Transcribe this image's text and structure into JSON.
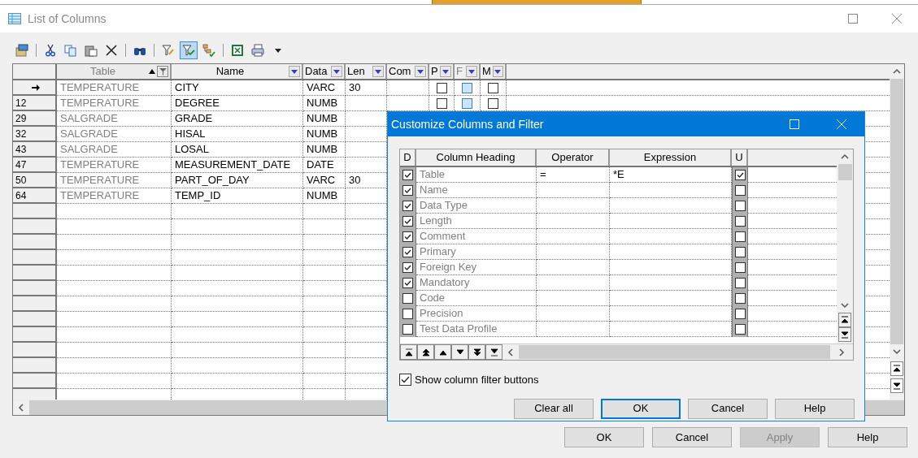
{
  "window": {
    "title": "List of Columns"
  },
  "toolbar": [
    {
      "kind": "properties",
      "pressed": false
    },
    {
      "kind": "separator"
    },
    {
      "kind": "cut",
      "pressed": false
    },
    {
      "kind": "copy",
      "pressed": false
    },
    {
      "kind": "paste",
      "pressed": false
    },
    {
      "kind": "delete",
      "pressed": false
    },
    {
      "kind": "separator"
    },
    {
      "kind": "find",
      "pressed": false
    },
    {
      "kind": "separator"
    },
    {
      "kind": "filter-edit",
      "pressed": false
    },
    {
      "kind": "filter-apply",
      "pressed": true
    },
    {
      "kind": "tree-check",
      "pressed": false
    },
    {
      "kind": "separator"
    },
    {
      "kind": "excel",
      "pressed": false
    },
    {
      "kind": "print",
      "pressed": false
    },
    {
      "kind": "caret",
      "pressed": false
    }
  ],
  "grid": {
    "columns": [
      {
        "label": "Table",
        "sorted": true,
        "filtered": true,
        "shaded": false
      },
      {
        "label": "Name",
        "sorted": false,
        "filtered": false,
        "shaded": false
      },
      {
        "label": "Data",
        "sorted": false,
        "filtered": false,
        "shaded": false
      },
      {
        "label": "Len",
        "sorted": false,
        "filtered": false,
        "shaded": false
      },
      {
        "label": "Com",
        "sorted": false,
        "filtered": false,
        "shaded": false
      },
      {
        "label": "P",
        "sorted": false,
        "filtered": false,
        "shaded": false
      },
      {
        "label": "F",
        "sorted": false,
        "filtered": false,
        "shaded": true
      },
      {
        "label": "M",
        "sorted": false,
        "filtered": false,
        "shaded": false
      }
    ],
    "rows": [
      {
        "current": true,
        "table": "TEMPERATURE",
        "name": "CITY",
        "data": "VARC",
        "len": "30",
        "flags": [
          false,
          false,
          false
        ]
      },
      {
        "current": false,
        "number": "12",
        "table": "TEMPERATURE",
        "name": "DEGREE",
        "data": "NUMB",
        "flags": [
          false,
          false,
          false
        ]
      },
      {
        "current": false,
        "number": "29",
        "table": "SALGRADE",
        "name": "GRADE",
        "data": "NUMB"
      },
      {
        "current": false,
        "number": "32",
        "table": "SALGRADE",
        "name": "HISAL",
        "data": "NUMB"
      },
      {
        "current": false,
        "number": "43",
        "table": "SALGRADE",
        "name": "LOSAL",
        "data": "NUMB"
      },
      {
        "current": false,
        "number": "47",
        "table": "TEMPERATURE",
        "name": "MEASUREMENT_DATE",
        "data": "DATE"
      },
      {
        "current": false,
        "number": "50",
        "table": "TEMPERATURE",
        "name": "PART_OF_DAY",
        "data": "VARC",
        "len": "30"
      },
      {
        "current": false,
        "number": "64",
        "table": "TEMPERATURE",
        "name": "TEMP_ID",
        "data": "NUMB"
      }
    ]
  },
  "buttons": [
    {
      "label": "OK",
      "disabled": false
    },
    {
      "label": "Cancel",
      "disabled": false
    },
    {
      "label": "Apply",
      "disabled": true
    },
    {
      "label": "Help",
      "disabled": false
    }
  ],
  "dialog": {
    "title": "Customize Columns and Filter",
    "columns": [
      "D",
      "Column Heading",
      "Operator",
      "Expression",
      "U"
    ],
    "rows": [
      {
        "heading": "Table",
        "operator": "=",
        "expression": "*E",
        "displayed": true,
        "u": true
      },
      {
        "heading": "Name",
        "displayed": true,
        "u": false
      },
      {
        "heading": "Data Type",
        "displayed": true,
        "u": false
      },
      {
        "heading": "Length",
        "displayed": true,
        "u": false
      },
      {
        "heading": "Comment",
        "displayed": true,
        "u": false
      },
      {
        "heading": "Primary",
        "displayed": true,
        "u": false
      },
      {
        "heading": "Foreign Key",
        "displayed": true,
        "u": false
      },
      {
        "heading": "Mandatory",
        "displayed": true,
        "u": false
      },
      {
        "heading": "Code",
        "displayed": false,
        "u": false
      },
      {
        "heading": "Precision",
        "displayed": false,
        "u": false
      },
      {
        "heading": "Test Data Profile",
        "displayed": false,
        "u": false
      }
    ],
    "show_filter_buttons": {
      "label": "Show column filter buttons",
      "checked": true
    },
    "buttons": [
      {
        "label": "Clear all",
        "default": false
      },
      {
        "label": "OK",
        "default": true
      },
      {
        "label": "Cancel",
        "default": false
      },
      {
        "label": "Help",
        "default": false
      }
    ]
  }
}
